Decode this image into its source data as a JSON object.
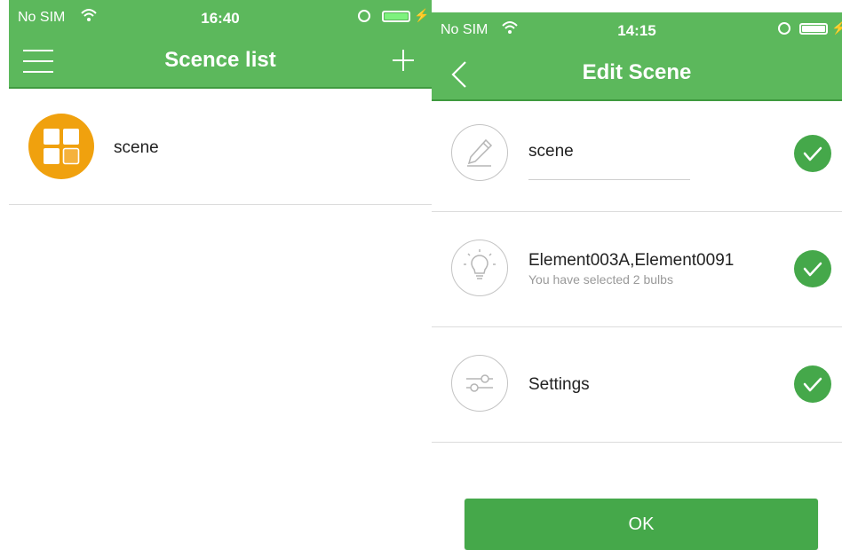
{
  "left_screen": {
    "status": {
      "carrier": "No SIM",
      "time": "16:40"
    },
    "nav": {
      "title": "Scence list",
      "left_icon": "menu-icon",
      "right_icon": "add-icon"
    },
    "scenes": [
      {
        "name": "scene",
        "icon": "scene-grid-icon",
        "icon_color": "#f0a10e"
      }
    ]
  },
  "right_screen": {
    "status": {
      "carrier": "No SIM",
      "time": "14:15"
    },
    "nav": {
      "title": "Edit Scene",
      "left_icon": "back-icon"
    },
    "rows": [
      {
        "icon": "pencil-icon",
        "value": "scene",
        "checked": true
      },
      {
        "icon": "bulb-icon",
        "title": "Element003A,Element0091",
        "subtitle": "You have selected 2 bulbs",
        "checked": true
      },
      {
        "icon": "sliders-icon",
        "title": "Settings",
        "checked": true
      }
    ],
    "ok_label": "OK"
  },
  "colors": {
    "header_green": "#5cb85c",
    "check_green": "#45a84a",
    "avatar_orange": "#f0a10e"
  }
}
